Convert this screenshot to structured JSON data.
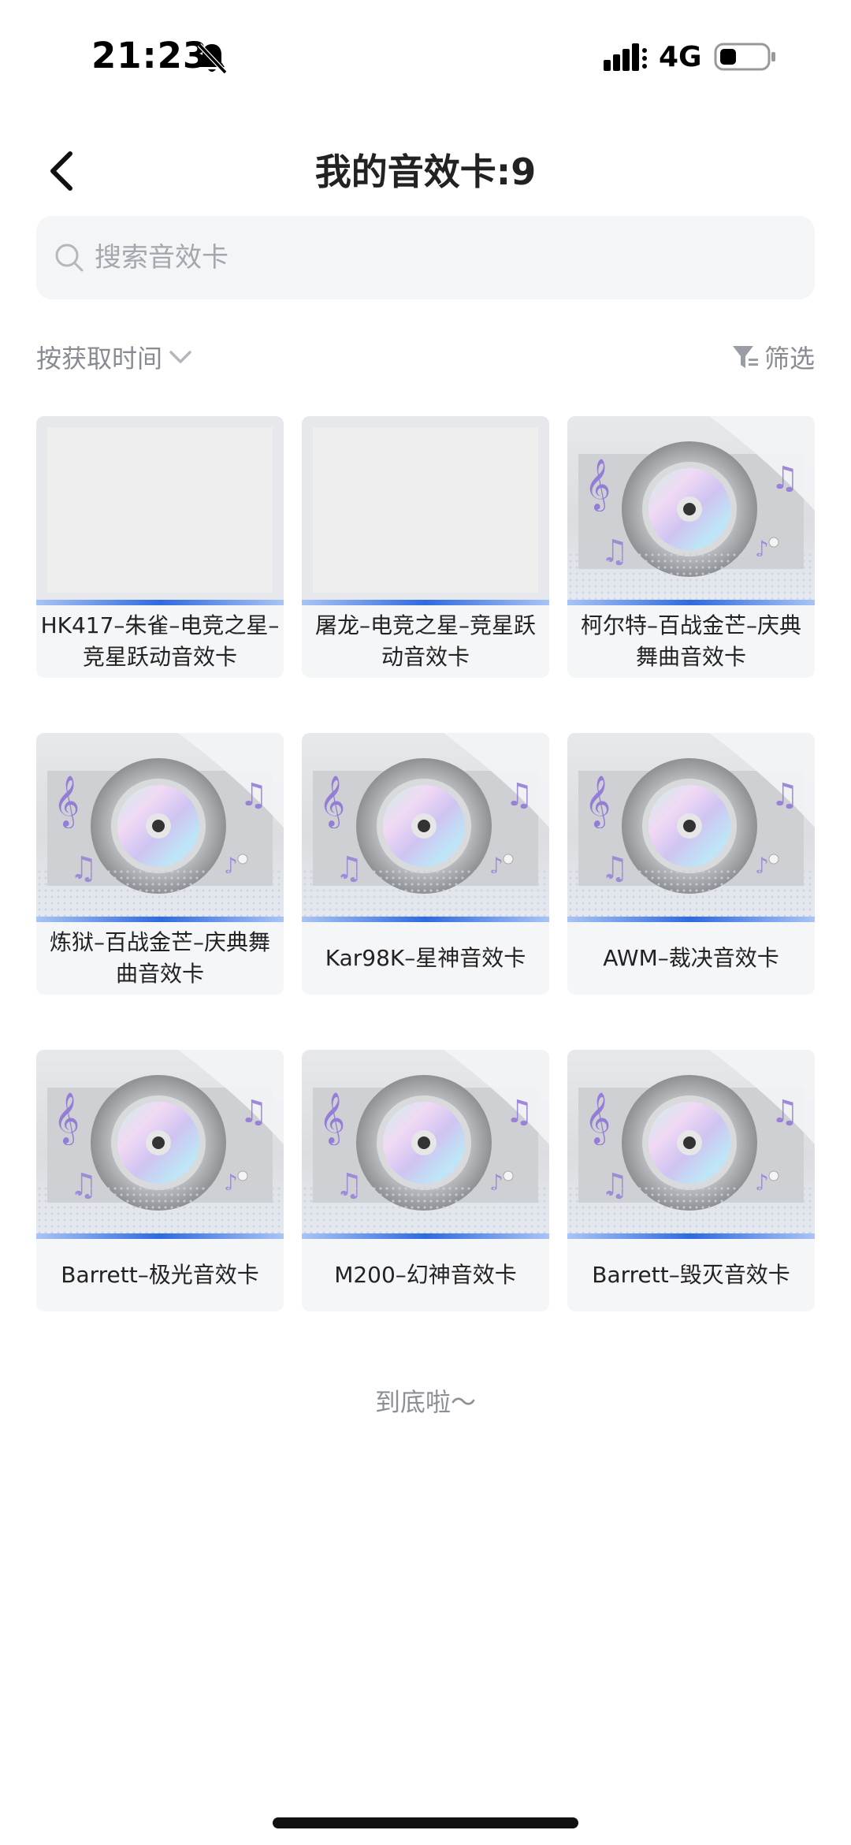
{
  "status_bar": {
    "time": "21:23",
    "network": "4G",
    "icons": [
      "bell-slash-icon",
      "signal-icon",
      "battery-icon"
    ]
  },
  "header": {
    "title": "我的音效卡:9",
    "back_icon": "chevron-left-icon"
  },
  "search": {
    "placeholder": "搜索音效卡",
    "value": "",
    "icon": "search-icon"
  },
  "toolbar": {
    "sort_label": "按获取时间",
    "sort_icon": "chevron-down-icon",
    "filter_label": "筛选",
    "filter_icon": "filter-icon"
  },
  "cards": [
    {
      "label": "HK417–朱雀–电竞之星–竞星跃动音效卡",
      "image": "placeholder"
    },
    {
      "label": "屠龙–电竞之星–竞星跃动音效卡",
      "image": "placeholder"
    },
    {
      "label": "柯尔特–百战金芒–庆典舞曲音效卡",
      "image": "cd-disc"
    },
    {
      "label": "炼狱–百战金芒–庆典舞曲音效卡",
      "image": "cd-disc"
    },
    {
      "label": "Kar98K–星神音效卡",
      "image": "cd-disc"
    },
    {
      "label": "AWM–裁决音效卡",
      "image": "cd-disc"
    },
    {
      "label": "Barrett–极光音效卡",
      "image": "cd-disc"
    },
    {
      "label": "M200–幻神音效卡",
      "image": "cd-disc"
    },
    {
      "label": "Barrett–毁灭音效卡",
      "image": "cd-disc"
    }
  ],
  "footer": {
    "end_text": "到底啦～"
  },
  "colors": {
    "accent_blue": "#2f6ae0",
    "card_bg": "#f5f6f8",
    "muted_text": "#888b92",
    "music_purple": "#8a6fd6"
  }
}
